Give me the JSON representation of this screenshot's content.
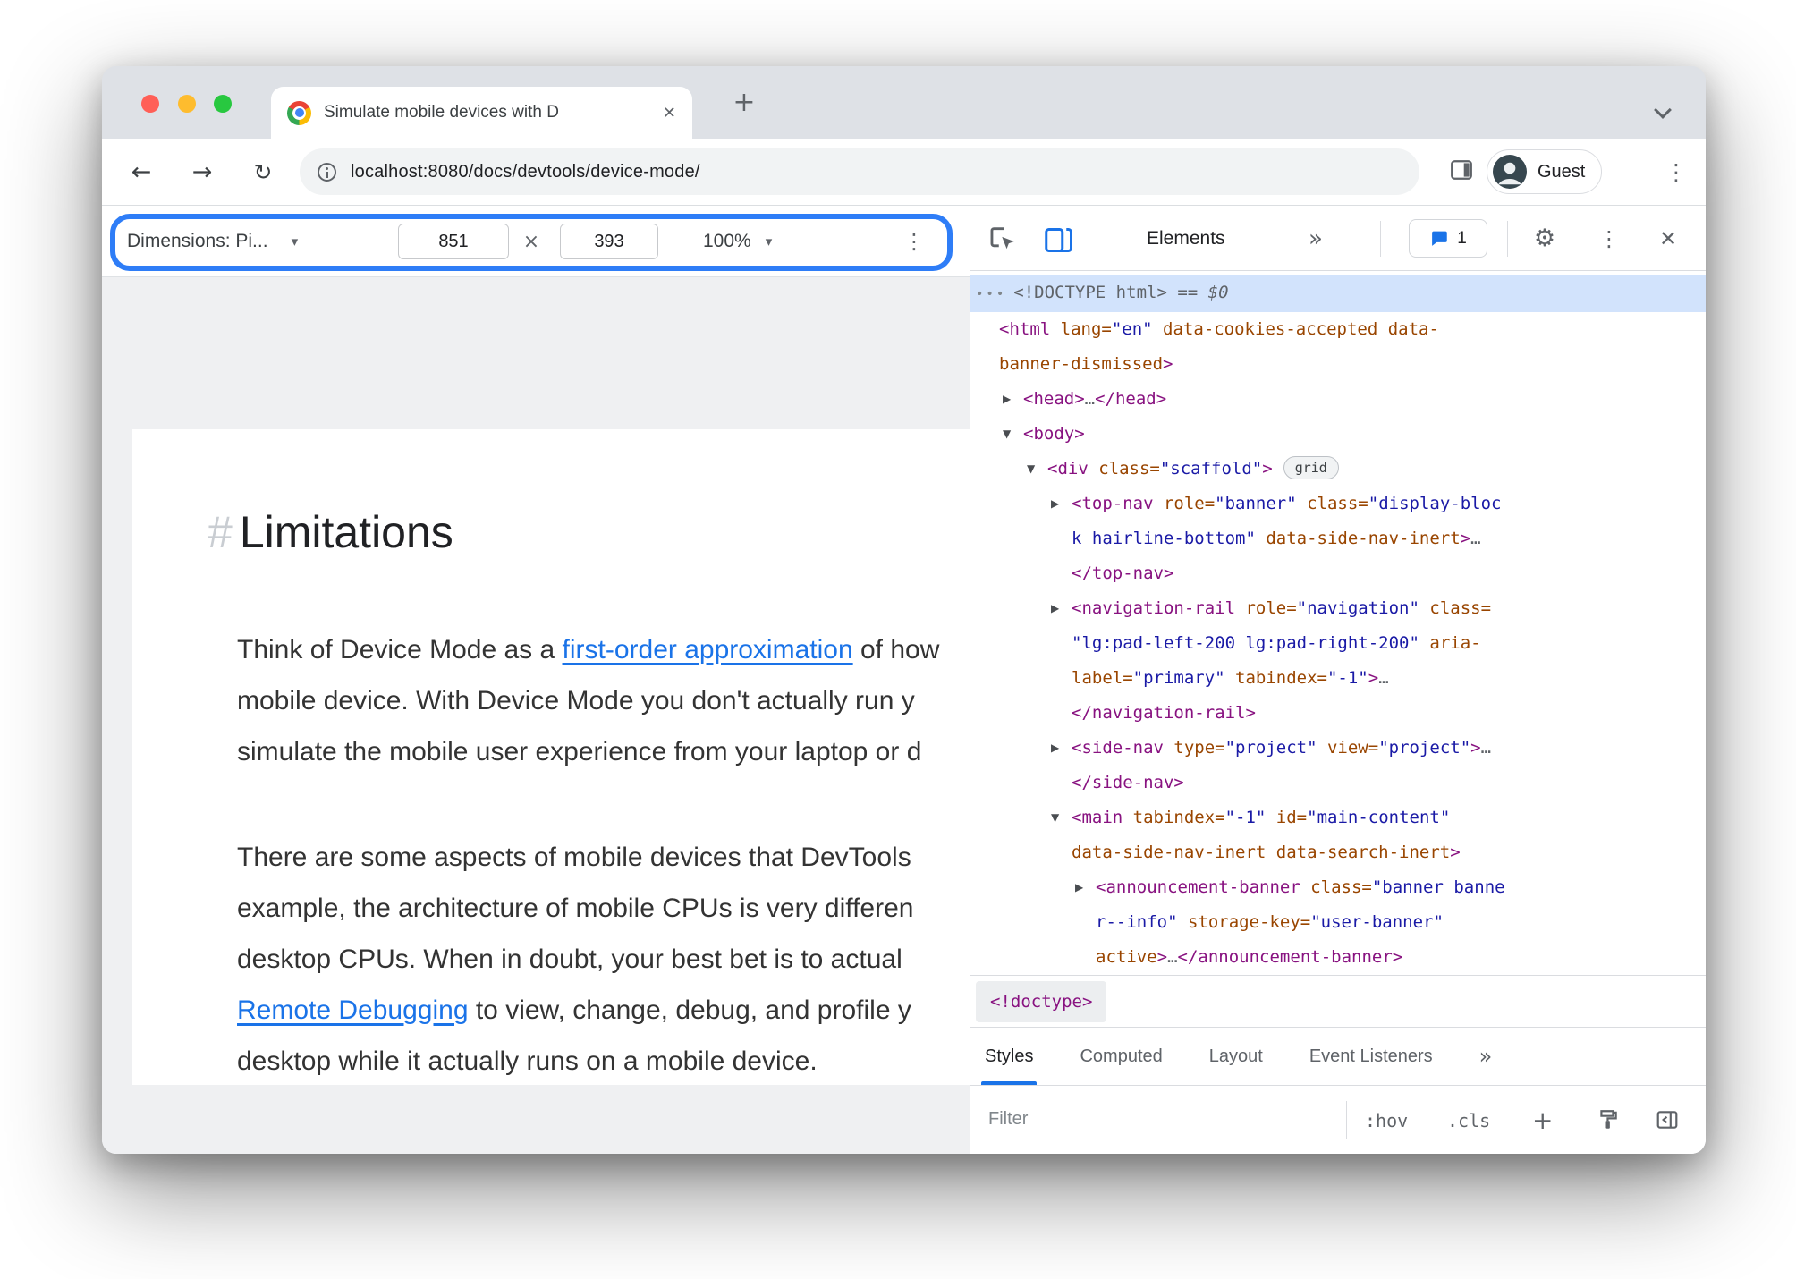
{
  "colors": {
    "accent_blue": "#1a73e8",
    "highlight_ring": "#2e7df7",
    "selection_bg": "#d2e3fc",
    "tag_color": "#881280",
    "attr_color": "#994500",
    "value_color": "#1a1aa6"
  },
  "icons": {
    "back": "←",
    "forward": "→",
    "reload": "↻",
    "new_tab": "+",
    "close": "✕",
    "kebab": "⋮",
    "gear": "⚙",
    "more": "»",
    "caret_down": "▾",
    "times": "×"
  },
  "browser": {
    "tab_title": "Simulate mobile devices with D",
    "url": "localhost:8080/docs/devtools/device-mode/",
    "guest_label": "Guest"
  },
  "device_toolbar": {
    "dimensions_label": "Dimensions: Pi...",
    "width_value": "851",
    "times": "×",
    "height_value": "393",
    "zoom_value": "100%"
  },
  "page": {
    "heading_hash": "#",
    "heading": "Limitations",
    "para1": [
      [
        {
          "t": "Think of Device Mode as a "
        },
        {
          "t": "first-order approximation",
          "link": true
        },
        {
          "t": " of how"
        }
      ],
      [
        {
          "t": "mobile device. With Device Mode you don't actually run y"
        }
      ],
      [
        {
          "t": "simulate the mobile user experience from your laptop or d"
        }
      ]
    ],
    "para2": [
      [
        {
          "t": "There are some aspects of mobile devices that DevTools"
        }
      ],
      [
        {
          "t": "example, the architecture of mobile CPUs is very differen"
        }
      ],
      [
        {
          "t": "desktop CPUs. When in doubt, your best bet is to actual"
        }
      ],
      [
        {
          "t": "Remote Debugging",
          "link": true
        },
        {
          "t": " to view, change, debug, and profile y"
        }
      ],
      [
        {
          "t": "desktop while it actually runs on a mobile device."
        }
      ]
    ]
  },
  "devtools": {
    "toolbar": {
      "elements_tab": "Elements",
      "issues_count": "1"
    },
    "tree": {
      "expand_icon": "▶",
      "collapse_icon": "▼",
      "lines": [
        {
          "ind": 0,
          "sel": true,
          "seg": [
            [
              "dots",
              "•••"
            ],
            [
              "doctype",
              "<!DOCTYPE html>"
            ],
            [
              "eq",
              " == "
            ],
            [
              "dollar",
              "$0"
            ]
          ]
        },
        {
          "ind": 0,
          "seg": [
            [
              "tag",
              "<html"
            ],
            [
              "attr",
              " lang="
            ],
            [
              "val",
              "\"en\""
            ],
            [
              "attr",
              " data-cookies-accepted data-"
            ]
          ]
        },
        {
          "ind": 0,
          "seg": [
            [
              "attr",
              "banner-dismissed"
            ],
            [
              "tag",
              ">"
            ]
          ]
        },
        {
          "ind": 1,
          "arrow": "closed",
          "seg": [
            [
              "tag",
              "<head>"
            ],
            [
              "gray",
              "…"
            ],
            [
              "tag",
              "</head>"
            ]
          ]
        },
        {
          "ind": 1,
          "arrow": "open",
          "seg": [
            [
              "tag",
              "<body>"
            ]
          ]
        },
        {
          "ind": 2,
          "arrow": "open",
          "seg": [
            [
              "tag",
              "<div"
            ],
            [
              "attr",
              " class="
            ],
            [
              "val",
              "\"scaffold\""
            ],
            [
              "tag",
              ">"
            ]
          ],
          "badge": "grid"
        },
        {
          "ind": 3,
          "arrow": "closed",
          "seg": [
            [
              "tag",
              "<top-nav"
            ],
            [
              "attr",
              " role="
            ],
            [
              "val",
              "\"banner\""
            ],
            [
              "attr",
              " class="
            ],
            [
              "val",
              "\"display-bloc"
            ]
          ]
        },
        {
          "ind": 3,
          "seg": [
            [
              "val",
              "k hairline-bottom\""
            ],
            [
              "attr",
              " data-side-nav-inert"
            ],
            [
              "tag",
              ">"
            ],
            [
              "gray",
              "…"
            ]
          ]
        },
        {
          "ind": 3,
          "seg": [
            [
              "tag",
              "</top-nav>"
            ]
          ]
        },
        {
          "ind": 3,
          "arrow": "closed",
          "seg": [
            [
              "tag",
              "<navigation-rail"
            ],
            [
              "attr",
              " role="
            ],
            [
              "val",
              "\"navigation\""
            ],
            [
              "attr",
              " class="
            ]
          ]
        },
        {
          "ind": 3,
          "seg": [
            [
              "val",
              "\"lg:pad-left-200 lg:pad-right-200\""
            ],
            [
              "attr",
              " aria-"
            ]
          ]
        },
        {
          "ind": 3,
          "seg": [
            [
              "attr",
              "label="
            ],
            [
              "val",
              "\"primary\""
            ],
            [
              "attr",
              " tabindex="
            ],
            [
              "val",
              "\"-1\""
            ],
            [
              "tag",
              ">"
            ],
            [
              "gray",
              "…"
            ]
          ]
        },
        {
          "ind": 3,
          "seg": [
            [
              "tag",
              "</navigation-rail>"
            ]
          ]
        },
        {
          "ind": 3,
          "arrow": "closed",
          "seg": [
            [
              "tag",
              "<side-nav"
            ],
            [
              "attr",
              " type="
            ],
            [
              "val",
              "\"project\""
            ],
            [
              "attr",
              " view="
            ],
            [
              "val",
              "\"project\""
            ],
            [
              "tag",
              ">"
            ],
            [
              "gray",
              "…"
            ]
          ]
        },
        {
          "ind": 3,
          "seg": [
            [
              "tag",
              "</side-nav>"
            ]
          ]
        },
        {
          "ind": 3,
          "arrow": "open",
          "seg": [
            [
              "tag",
              "<main"
            ],
            [
              "attr",
              " tabindex="
            ],
            [
              "val",
              "\"-1\""
            ],
            [
              "attr",
              " id="
            ],
            [
              "val",
              "\"main-content\""
            ]
          ]
        },
        {
          "ind": 3,
          "seg": [
            [
              "attr",
              "data-side-nav-inert data-search-inert"
            ],
            [
              "tag",
              ">"
            ]
          ]
        },
        {
          "ind": 4,
          "arrow": "closed",
          "seg": [
            [
              "tag",
              "<announcement-banner"
            ],
            [
              "attr",
              " class="
            ],
            [
              "val",
              "\"banner banne"
            ]
          ]
        },
        {
          "ind": 4,
          "seg": [
            [
              "val",
              "r--info\""
            ],
            [
              "attr",
              " storage-key="
            ],
            [
              "val",
              "\"user-banner\""
            ]
          ]
        },
        {
          "ind": 4,
          "seg": [
            [
              "attr",
              "active"
            ],
            [
              "tag",
              ">"
            ],
            [
              "gray",
              "…"
            ],
            [
              "tag",
              "</announcement-banner>"
            ]
          ]
        }
      ]
    },
    "breadcrumb": "<!doctype>",
    "sidebar_tabs": [
      {
        "label": "Styles"
      },
      {
        "label": "Computed"
      },
      {
        "label": "Layout"
      },
      {
        "label": "Event Listeners"
      }
    ],
    "styles_bar": {
      "filter_placeholder": "Filter",
      "hov_label": ":hov",
      "cls_label": ".cls",
      "plus_label": "+"
    }
  }
}
